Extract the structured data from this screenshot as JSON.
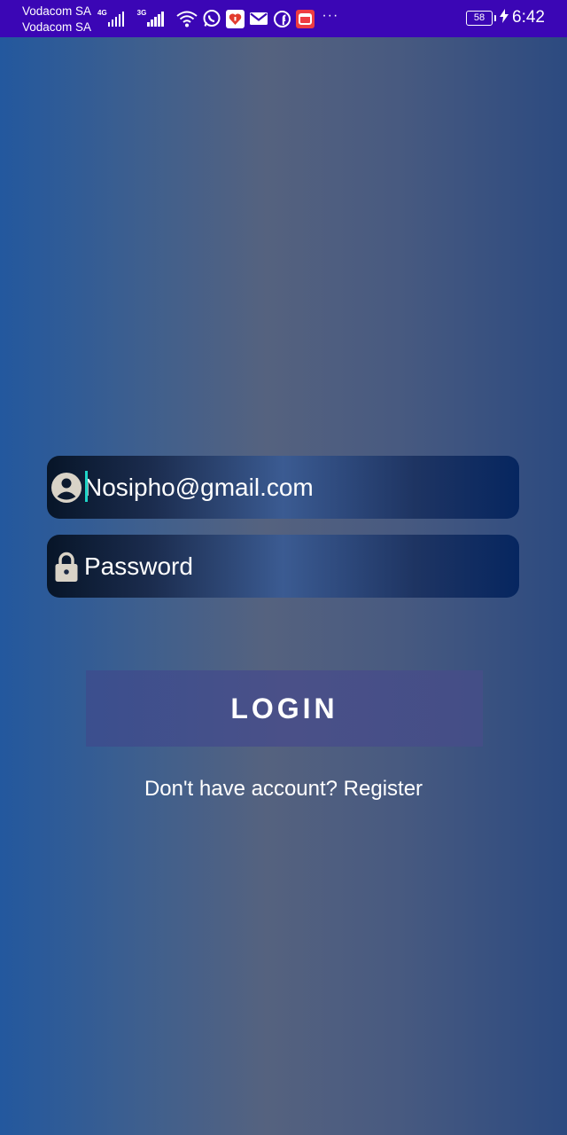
{
  "status_bar": {
    "carrier_1": "Vodacom SA",
    "carrier_2": "Vodacom SA",
    "network_1": "4G",
    "network_2": "3G",
    "icons": [
      "signal-4g-icon",
      "signal-3g-icon",
      "wifi-icon",
      "whatsapp-icon",
      "app-notification-icon",
      "gmail-icon",
      "facebook-icon",
      "calendar-notification-icon",
      "more-notifications-icon"
    ],
    "more": "···",
    "battery_level": "58",
    "time": "6:42",
    "bar_color": "#3b06b5"
  },
  "login_form": {
    "email": {
      "icon": "account-circle-icon",
      "value": "Nosipho@gmail.com"
    },
    "password": {
      "icon": "lock-icon",
      "placeholder": "Password"
    },
    "login_button_label": "LOGIN",
    "register_prompt": "Don't have account? Register"
  },
  "colors": {
    "caret": "#1fd4c7",
    "icon": "#d9d3c7",
    "text": "#ffffff"
  }
}
